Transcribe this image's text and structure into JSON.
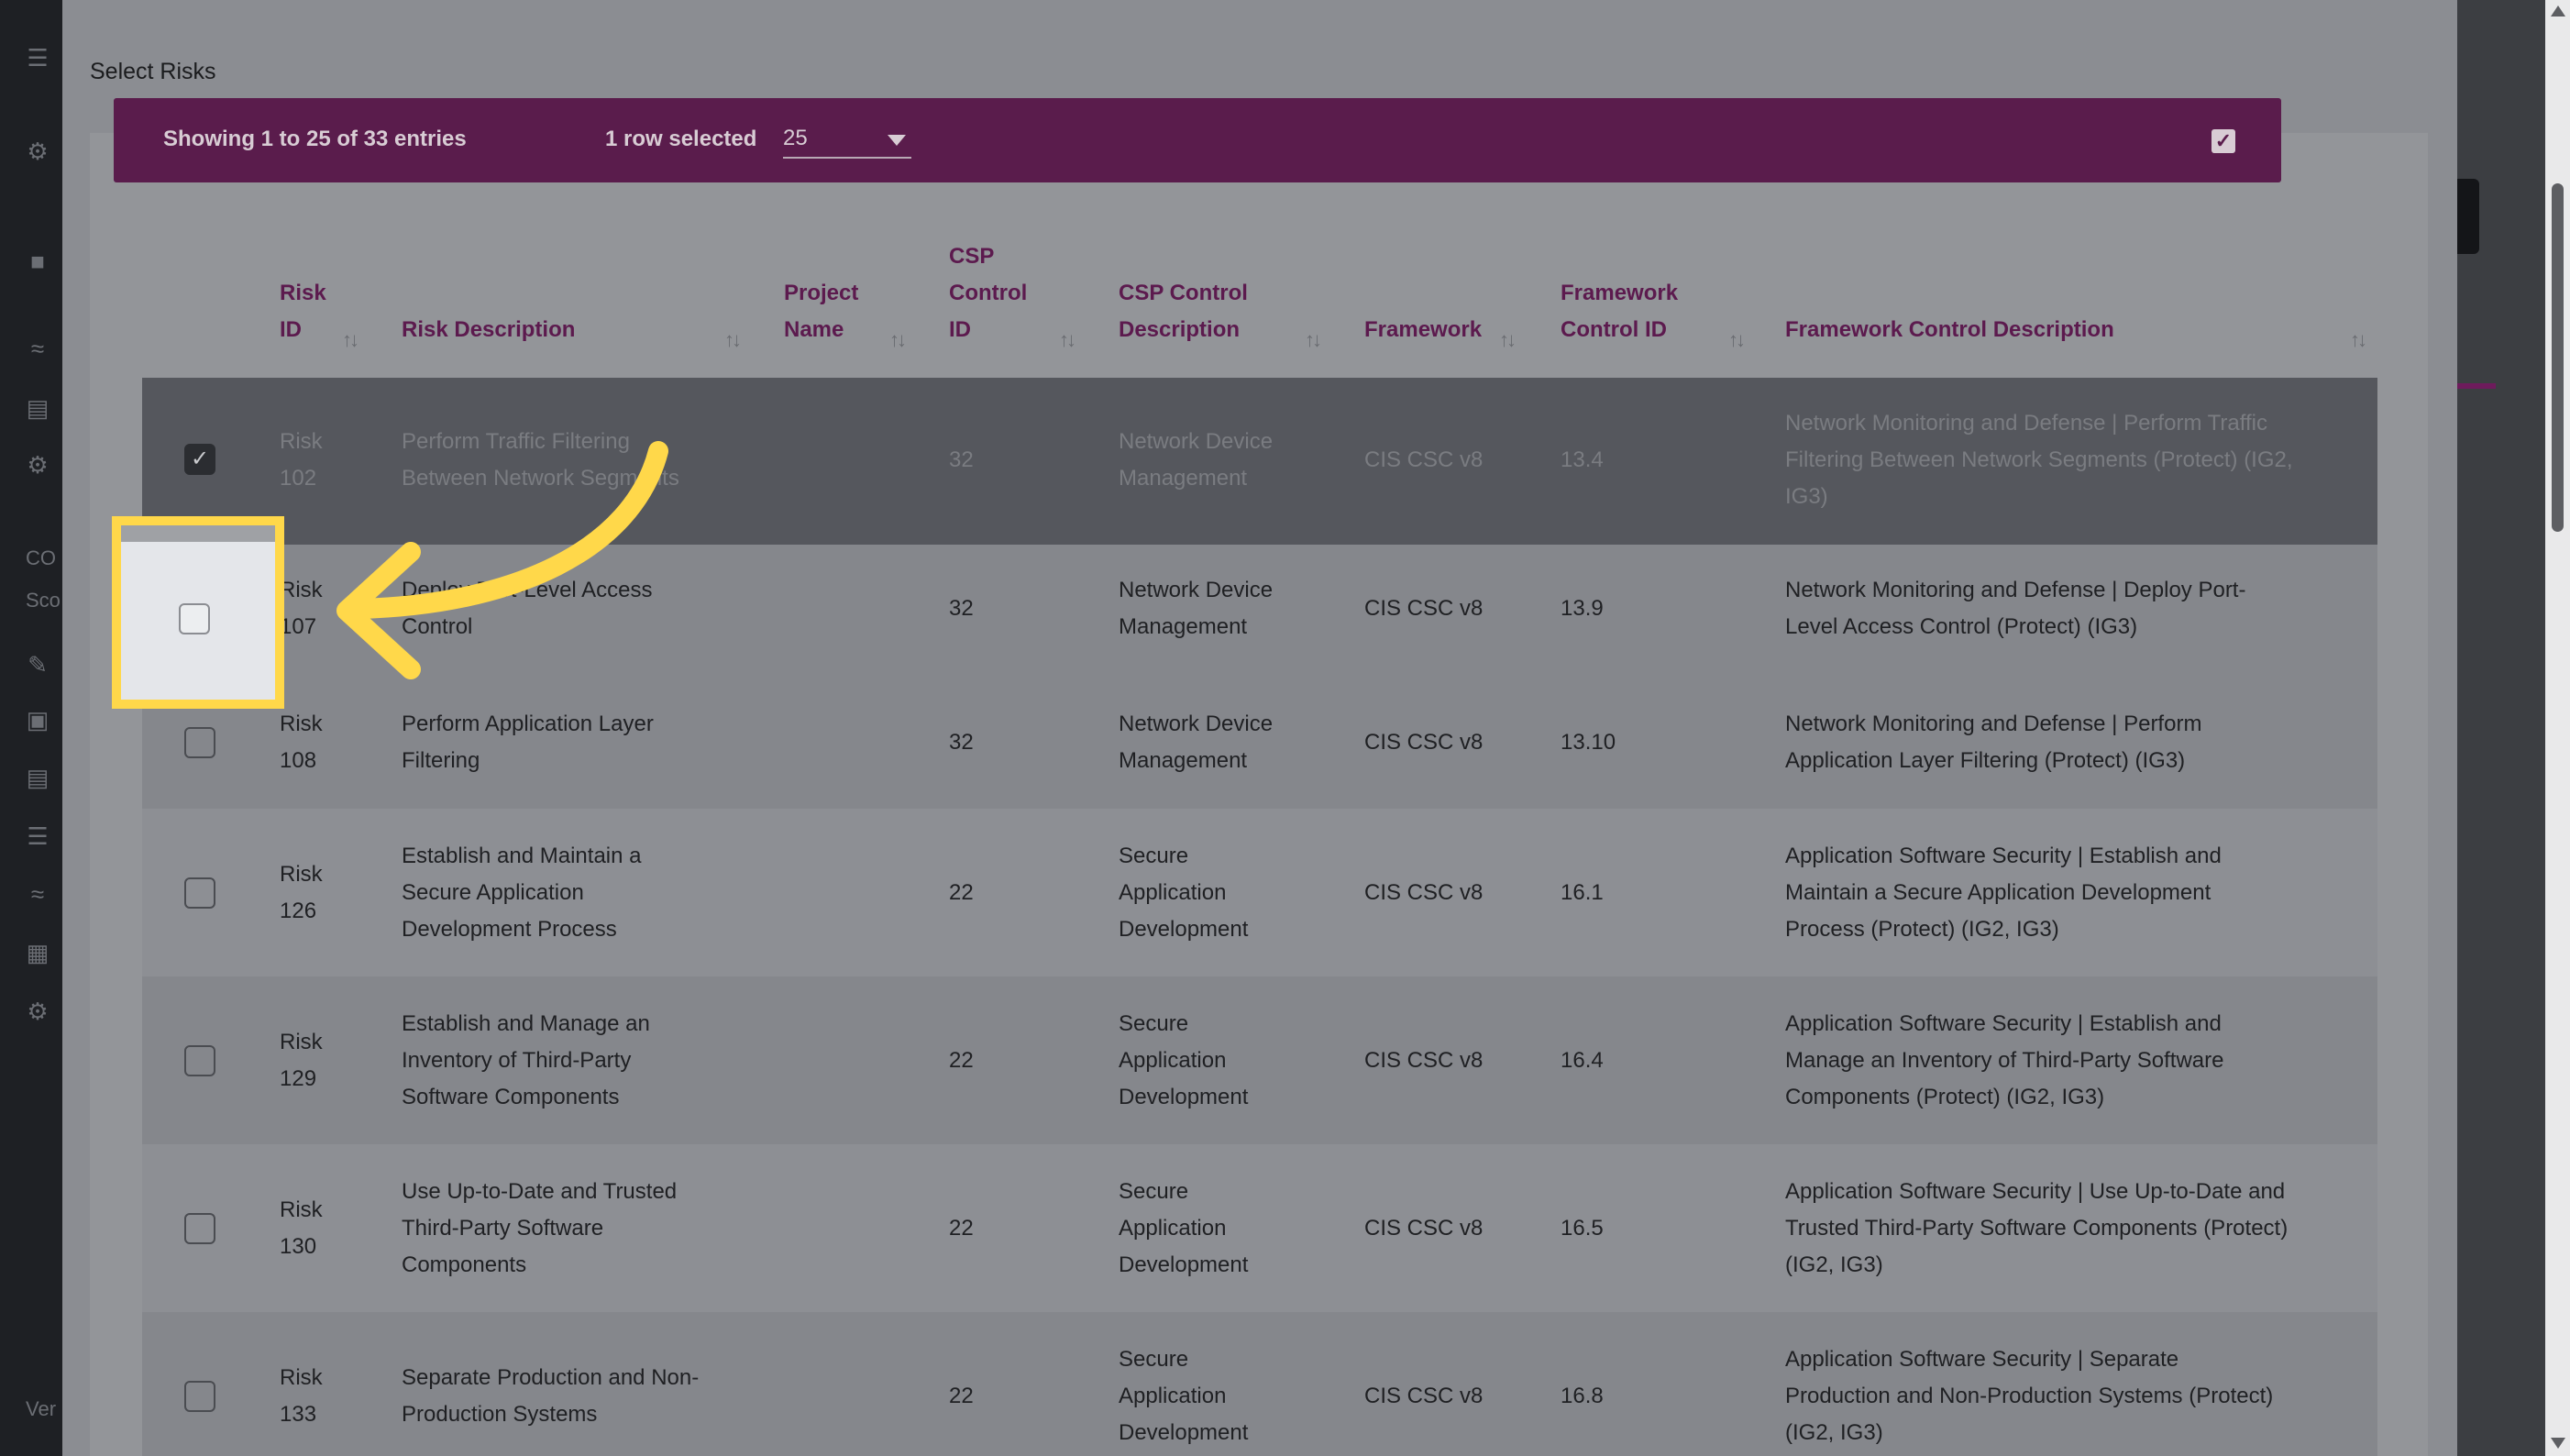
{
  "dialog": {
    "title": "Select Risks"
  },
  "toolbar": {
    "entries_info": "Showing 1 to 25 of 33 entries",
    "selection_info": "1 row selected",
    "page_size": "25"
  },
  "background": {
    "sidebar_text_1": "CO",
    "sidebar_text_2": "Sco",
    "sidebar_text_3": "Ver"
  },
  "table": {
    "columns": [
      {
        "line1": "Risk",
        "line2": "ID"
      },
      {
        "line1": "Risk Description",
        "line2": ""
      },
      {
        "line1": "Project",
        "line2": "Name"
      },
      {
        "line1": "CSP",
        "line2": "Control",
        "line3": "ID"
      },
      {
        "line1": "CSP Control",
        "line2": "Description"
      },
      {
        "line1": "Framework",
        "line2": ""
      },
      {
        "line1": "Framework",
        "line2": "Control ID"
      },
      {
        "line1": "Framework Control Description",
        "line2": ""
      }
    ],
    "rows": [
      {
        "checked": true,
        "risk_id": [
          "Risk",
          "102"
        ],
        "description": [
          "Perform Traffic Filtering",
          "Between Network Segments"
        ],
        "project": "",
        "csp_id": "32",
        "csp_desc": [
          "Network Device",
          "Management"
        ],
        "framework": "CIS CSC v8",
        "fw_id": "13.4",
        "fw_desc": [
          "Network Monitoring and Defense | Perform Traffic",
          "Filtering Between Network Segments (Protect) (IG2,",
          "IG3)"
        ]
      },
      {
        "checked": false,
        "risk_id": [
          "Risk",
          "107"
        ],
        "description": [
          "Deploy Port-Level Access",
          "Control"
        ],
        "project": "",
        "csp_id": "32",
        "csp_desc": [
          "Network Device",
          "Management"
        ],
        "framework": "CIS CSC v8",
        "fw_id": "13.9",
        "fw_desc": [
          "Network Monitoring and Defense | Deploy Port-",
          "Level Access Control (Protect) (IG3)"
        ]
      },
      {
        "checked": false,
        "risk_id": [
          "Risk",
          "108"
        ],
        "description": [
          "Perform Application Layer",
          "Filtering"
        ],
        "project": "",
        "csp_id": "32",
        "csp_desc": [
          "Network Device",
          "Management"
        ],
        "framework": "CIS CSC v8",
        "fw_id": "13.10",
        "fw_desc": [
          "Network Monitoring and Defense | Perform",
          "Application Layer Filtering (Protect) (IG3)"
        ]
      },
      {
        "checked": false,
        "risk_id": [
          "Risk",
          "126"
        ],
        "description": [
          "Establish and Maintain a",
          "Secure Application",
          "Development Process"
        ],
        "project": "",
        "csp_id": "22",
        "csp_desc": [
          "Secure",
          "Application",
          "Development"
        ],
        "framework": "CIS CSC v8",
        "fw_id": "16.1",
        "fw_desc": [
          "Application Software Security | Establish and",
          "Maintain a Secure Application Development",
          "Process (Protect) (IG2, IG3)"
        ]
      },
      {
        "checked": false,
        "risk_id": [
          "Risk",
          "129"
        ],
        "description": [
          "Establish and Manage an",
          "Inventory of Third-Party",
          "Software Components"
        ],
        "project": "",
        "csp_id": "22",
        "csp_desc": [
          "Secure",
          "Application",
          "Development"
        ],
        "framework": "CIS CSC v8",
        "fw_id": "16.4",
        "fw_desc": [
          "Application Software Security | Establish and",
          "Manage an Inventory of Third-Party Software",
          "Components (Protect) (IG2, IG3)"
        ]
      },
      {
        "checked": false,
        "risk_id": [
          "Risk",
          "130"
        ],
        "description": [
          "Use Up-to-Date and Trusted",
          "Third-Party Software",
          "Components"
        ],
        "project": "",
        "csp_id": "22",
        "csp_desc": [
          "Secure",
          "Application",
          "Development"
        ],
        "framework": "CIS CSC v8",
        "fw_id": "16.5",
        "fw_desc": [
          "Application Software Security | Use Up-to-Date and",
          "Trusted Third-Party Software Components (Protect)",
          "(IG2, IG3)"
        ]
      },
      {
        "checked": false,
        "risk_id": [
          "Risk",
          "133"
        ],
        "description": [
          "Separate Production and Non-",
          "Production Systems"
        ],
        "project": "",
        "csp_id": "22",
        "csp_desc": [
          "Secure",
          "Application",
          "Development"
        ],
        "framework": "CIS CSC v8",
        "fw_id": "16.8",
        "fw_desc": [
          "Application Software Security | Separate",
          "Production and Non-Production Systems (Protect)",
          "(IG2, IG3)"
        ]
      }
    ]
  },
  "colors": {
    "accent": "#5a1c4c",
    "highlight": "#ffd84a"
  }
}
